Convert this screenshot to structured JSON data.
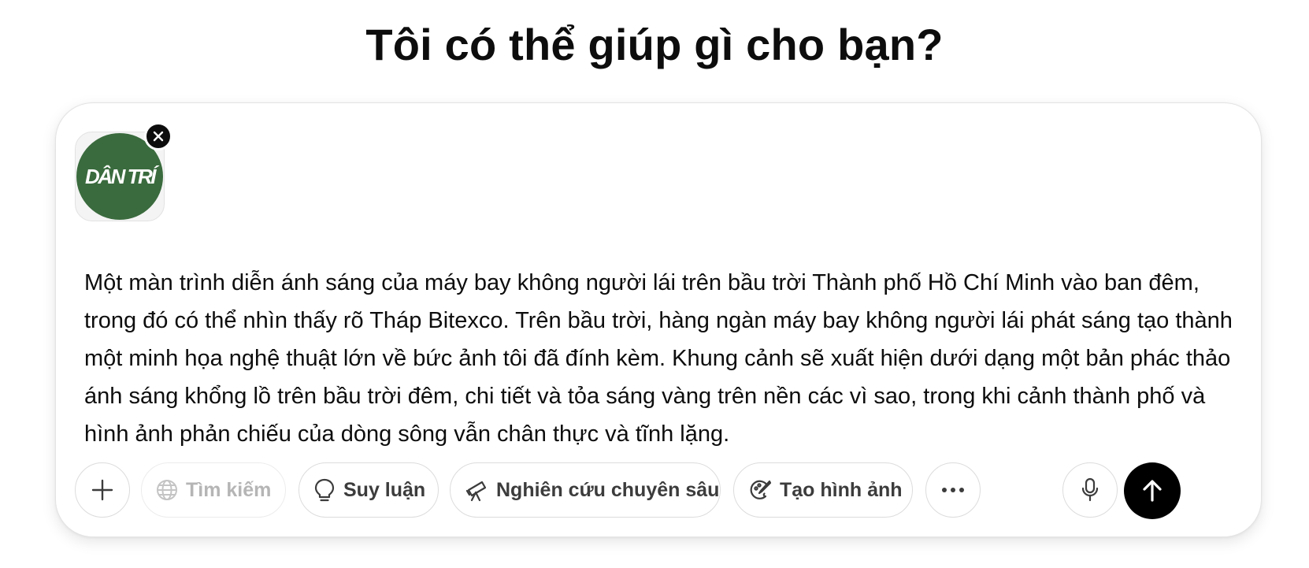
{
  "heading": "Tôi có thể giúp gì cho bạn?",
  "attachment": {
    "logo_text": "DÂN TRÍ",
    "logo_color": "#3a6b3e"
  },
  "prompt_text": "Một màn trình diễn ánh sáng của máy bay không người lái trên bầu trời Thành phố Hồ Chí Minh vào ban đêm, trong đó có thể nhìn thấy rõ Tháp Bitexco. Trên bầu trời, hàng ngàn máy bay không người lái phát sáng tạo thành một minh họa nghệ thuật lớn về bức ảnh tôi đã đính kèm. Khung cảnh sẽ xuất hiện dưới dạng một bản phác thảo ánh sáng khổng lồ trên bầu trời đêm, chi tiết và tỏa sáng vàng trên nền các vì sao, trong khi cảnh thành phố và hình ảnh phản chiếu của dòng sông vẫn chân thực và tĩnh lặng.",
  "toolbar": {
    "search_label": "Tìm kiếm",
    "reason_label": "Suy luận",
    "deep_research_label": "Nghiên cứu chuyên sâu",
    "create_image_label": "Tạo hình ảnh"
  },
  "icons": {
    "add": "plus-icon",
    "search": "globe-icon",
    "reason": "lightbulb-icon",
    "deep_research": "telescope-icon",
    "create_image": "palette-icon",
    "more": "ellipsis-icon",
    "voice": "microphone-icon",
    "send": "arrow-up-icon",
    "remove": "close-icon"
  }
}
